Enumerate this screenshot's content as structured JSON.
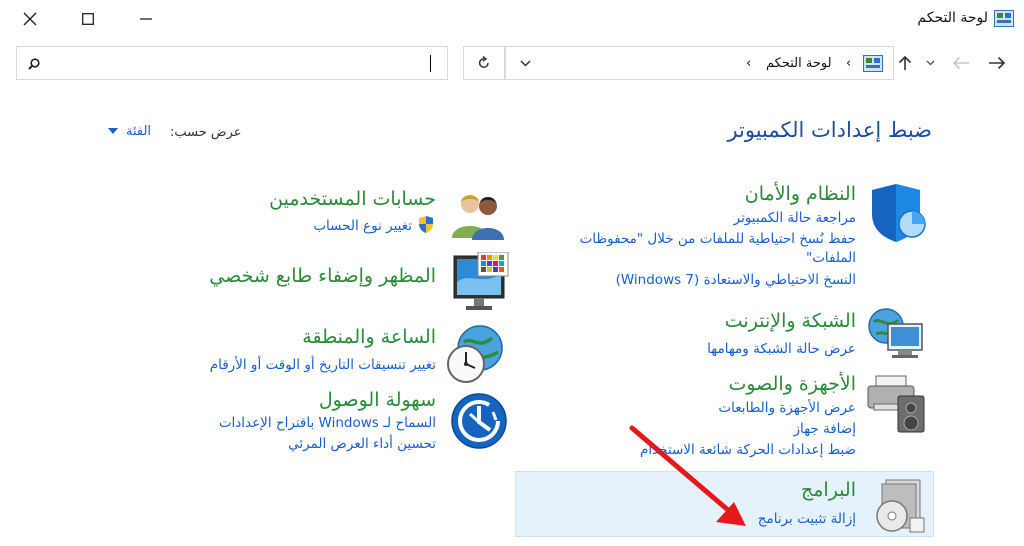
{
  "window": {
    "title": "لوحة التحكم"
  },
  "address_bar": {
    "breadcrumb": "لوحة التحكم",
    "separator": "›"
  },
  "search": {
    "value": ""
  },
  "header": {
    "title": "ضبط إعدادات الكمبيوتر",
    "view_by_label": "عرض حسب:",
    "view_by_value": "الفئة"
  },
  "categories": {
    "system": {
      "title": "النظام والأمان",
      "links": [
        "مراجعة حالة الكمبيوتر",
        "حفظ نُسخ احتياطية للملفات من خلال \"محفوظات",
        "الملفات\"",
        "النسخ الاحتياطي والاستعادة (Windows 7)"
      ]
    },
    "network": {
      "title": "الشبكة والإنترنت",
      "links": [
        "عرض حالة الشبكة ومهامها"
      ]
    },
    "hardware": {
      "title": "الأجهزة والصوت",
      "links": [
        "عرض الأجهزة والطابعات",
        "إضافة جهاز",
        "ضبط إعدادات الحركة شائعة الاستخدام"
      ]
    },
    "programs": {
      "title": "البرامج",
      "links": [
        "إزالة تثبيت برنامج"
      ]
    },
    "users": {
      "title": "حسابات المستخدمين",
      "links": [
        "تغيير نوع الحساب"
      ]
    },
    "appearance": {
      "title": "المظهر وإضفاء طابع شخصي"
    },
    "clock": {
      "title": "الساعة والمنطقة",
      "links": [
        "تغيير تنسيقات التاريخ أو الوقت أو الأرقام"
      ]
    },
    "ease": {
      "title": "سهولة الوصول",
      "links": [
        "السماح لـ Windows باقتراح الإعدادات",
        "تحسين أداء العرض المرئي"
      ]
    }
  },
  "colors": {
    "category_title": "#2a8a3a",
    "link": "#1a5ec9",
    "heading": "#1e4d9b",
    "highlight": "#e5f1fb",
    "annotation_arrow": "#e3191b"
  }
}
